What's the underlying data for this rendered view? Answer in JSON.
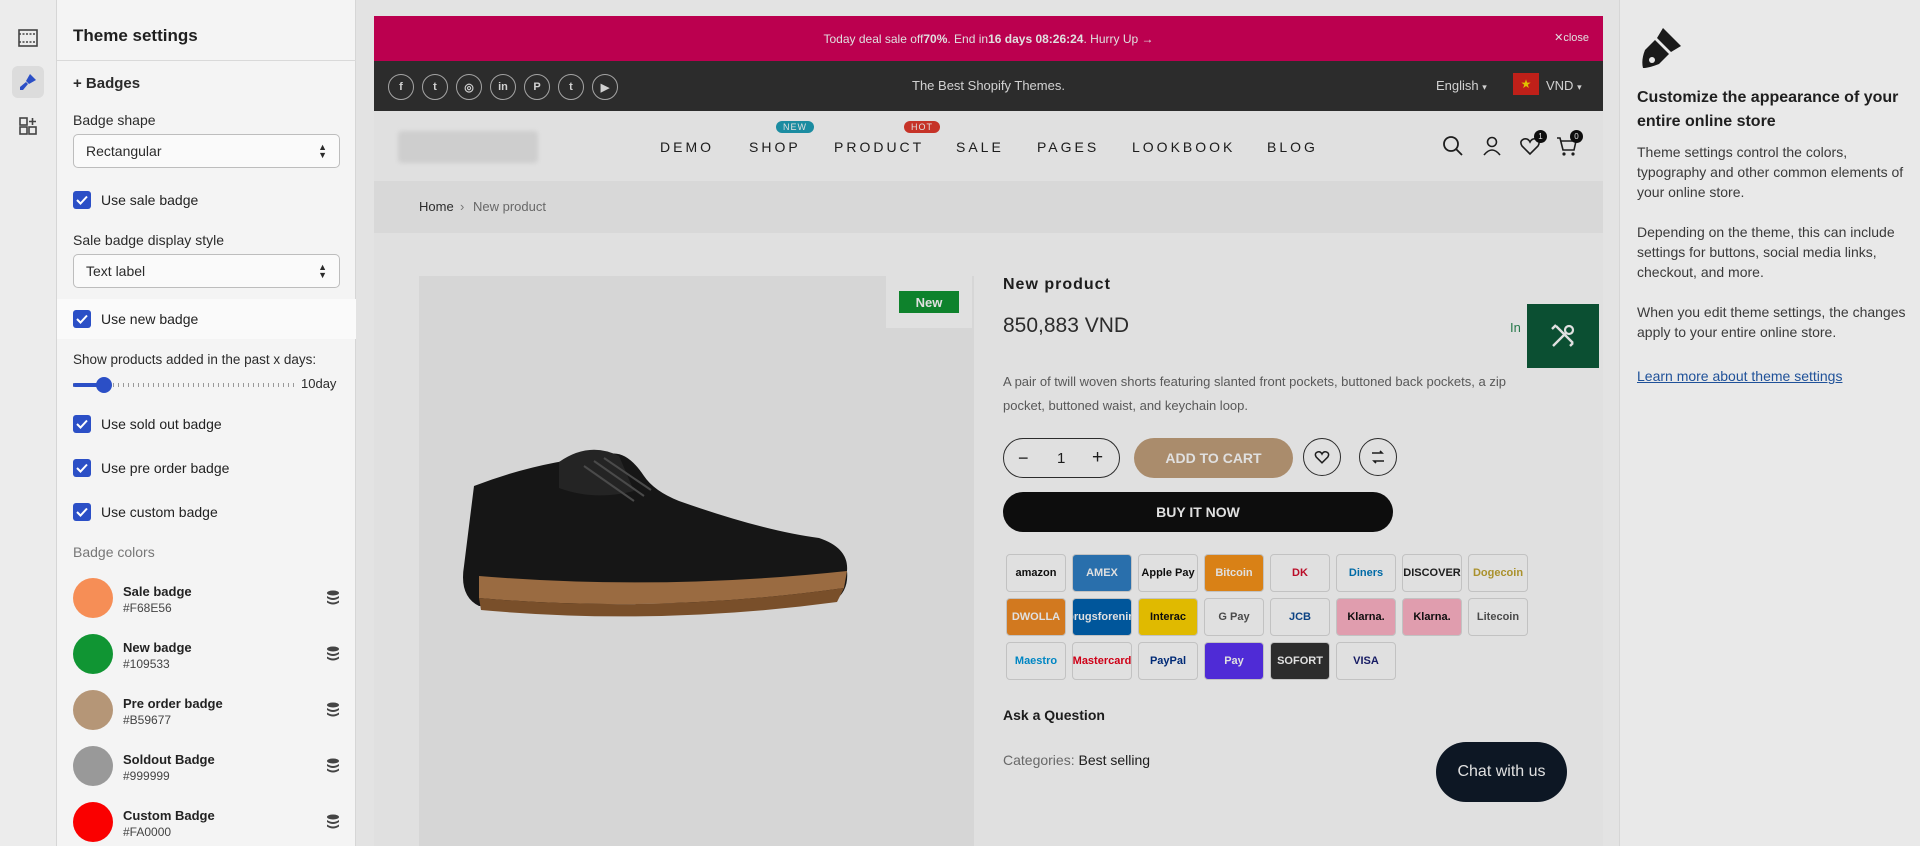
{
  "settings": {
    "title": "Theme settings",
    "section": "+ Badges",
    "badge_shape_label": "Badge shape",
    "badge_shape_value": "Rectangular",
    "use_sale_badge": "Use sale badge",
    "sale_style_label": "Sale badge display style",
    "sale_style_value": "Text label",
    "use_new_badge": "Use new badge",
    "days_label": "Show products added in the past x days:",
    "days_value": "10day",
    "days_fraction": 0.14,
    "use_sold_out": "Use sold out badge",
    "use_pre_order": "Use pre order badge",
    "use_custom": "Use custom badge",
    "colors_label": "Badge colors",
    "swatches": [
      {
        "name": "Sale badge",
        "hex": "#F68E56"
      },
      {
        "name": "New badge",
        "hex": "#109533"
      },
      {
        "name": "Pre order badge",
        "hex": "#B59677"
      },
      {
        "name": "Soldout Badge",
        "hex": "#999999"
      },
      {
        "name": "Custom Badge",
        "hex": "#FA0000"
      }
    ]
  },
  "store": {
    "promo_prefix": "Today deal sale off ",
    "promo_pct": "70%",
    "promo_mid": ". End in ",
    "promo_days": "16 days 08:26:24",
    "promo_suffix": ". Hurry Up →",
    "promo_close": "close",
    "tagline": "The Best Shopify Themes.",
    "language": "English",
    "currency": "VND",
    "menu": [
      "DEMO",
      "SHOP",
      "PRODUCT",
      "SALE",
      "PAGES",
      "LOOKBOOK",
      "BLOG"
    ],
    "menu_badges": {
      "shop": "NEW",
      "product": "HOT"
    },
    "wishlist_count": "1",
    "cart_count": "0",
    "breadcrumb_home": "Home",
    "breadcrumb_current": "New product",
    "badge_text": "New",
    "product_title": "New product",
    "price": "850,883 VND",
    "stock": "In",
    "description": "A pair of twill woven shorts featuring slanted front pockets, buttoned back pockets, a zip pocket, buttoned waist, and keychain loop.",
    "qty": "1",
    "add_to_cart": "ADD TO CART",
    "buy_now": "BUY IT NOW",
    "payments": [
      "amazon",
      "AMEX",
      "Apple Pay",
      "Bitcoin",
      "DK",
      "Diners",
      "DISCOVER",
      "Dogecoin",
      "DWOLLA",
      "Forbrugsforeningen",
      "Interac",
      "G Pay",
      "JCB",
      "Klarna.",
      "Klarna.",
      "Litecoin",
      "Maestro",
      "Mastercard",
      "PayPal",
      "Pay",
      "SOFORT",
      "VISA"
    ],
    "ask": "Ask a Question",
    "categories_label": "Categories:",
    "categories_value": "Best selling",
    "chat": "Chat with us"
  },
  "info": {
    "title": "Customize the appearance of your entire online store",
    "p1": "Theme settings control the colors, typography and other common elements of your online store.",
    "p2": "Depending on the theme, this can include settings for buttons, social media links, checkout, and more.",
    "p3": "When you edit theme settings, the changes apply to your entire online store.",
    "link": "Learn more about theme settings"
  },
  "colors": {
    "accent": "#2B4FC6",
    "promo": "#D5005A",
    "new_badge": "#109533",
    "add_to_cart": "#C2A07C"
  }
}
